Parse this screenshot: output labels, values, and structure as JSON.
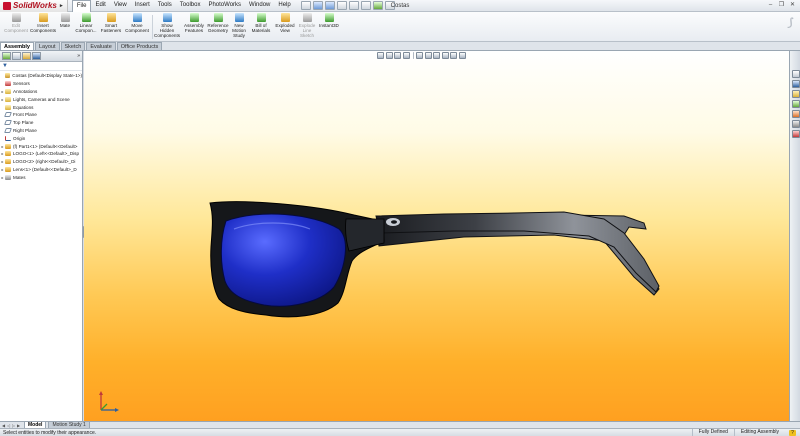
{
  "app": {
    "name": "SolidWorks",
    "document_title": "Costas"
  },
  "menu": [
    "File",
    "Edit",
    "View",
    "Insert",
    "Tools",
    "Toolbox",
    "PhotoWorks",
    "Window",
    "Help"
  ],
  "ribbon": [
    {
      "label": "Edit Component",
      "icon": "edit-component-icon",
      "disabled": true
    },
    {
      "label": "Insert Components",
      "icon": "insert-components-icon"
    },
    {
      "label": "Mate",
      "icon": "mate-icon"
    },
    {
      "label": "Linear Compon...",
      "icon": "linear-pattern-icon"
    },
    {
      "label": "Smart Fasteners",
      "icon": "smart-fasteners-icon"
    },
    {
      "label": "Move Component",
      "icon": "move-component-icon"
    },
    {
      "label": "Show Hidden Components",
      "icon": "show-hidden-icon"
    },
    {
      "label": "Assembly Features",
      "icon": "assembly-features-icon"
    },
    {
      "label": "Reference Geometry",
      "icon": "reference-geometry-icon"
    },
    {
      "label": "New Motion Study",
      "icon": "motion-study-icon"
    },
    {
      "label": "Bill of Materials",
      "icon": "bom-icon"
    },
    {
      "label": "Exploded View",
      "icon": "exploded-view-icon"
    },
    {
      "label": "Explode Line Sketch",
      "icon": "explode-line-icon",
      "disabled": true
    },
    {
      "label": "Instant3D",
      "icon": "instant3d-icon"
    }
  ],
  "command_tabs": [
    "Assembly",
    "Layout",
    "Sketch",
    "Evaluate",
    "Office Products"
  ],
  "tree": {
    "root": "Costas (Default<Display State-1>)",
    "items": [
      {
        "label": "Sensors",
        "icon": "sensor"
      },
      {
        "label": "Annotations",
        "icon": "folder",
        "expand": true
      },
      {
        "label": "Lights, Cameras and Scene",
        "icon": "folder",
        "expand": true
      },
      {
        "label": "Equations",
        "icon": "folder"
      },
      {
        "label": "Front Plane",
        "icon": "plane"
      },
      {
        "label": "Top Plane",
        "icon": "plane"
      },
      {
        "label": "Right Plane",
        "icon": "plane"
      },
      {
        "label": "Origin",
        "icon": "origin"
      },
      {
        "label": "(f) Part1<1> (Default<<Default>",
        "icon": "part",
        "expand": true
      },
      {
        "label": "LOGO<1> (Left<<Default>_Disp",
        "icon": "part",
        "expand": true
      },
      {
        "label": "LOGO<2> (right<<Default>_Di",
        "icon": "part",
        "expand": true
      },
      {
        "label": "Lens<1> (Default<<Default>_D",
        "icon": "part",
        "expand": true
      },
      {
        "label": "Mates",
        "icon": "mate",
        "expand": true
      }
    ]
  },
  "bottom_tabs": [
    "Model",
    "Motion Study 1"
  ],
  "status": {
    "message": "Select entities to modify their appearance.",
    "state": "Fully Defined",
    "mode": "Editing Assembly"
  },
  "colors": {
    "frame": "#15171a",
    "lens": "#1f2fc8",
    "viewport_top": "#ffffff",
    "viewport_bottom": "#ffa020"
  }
}
